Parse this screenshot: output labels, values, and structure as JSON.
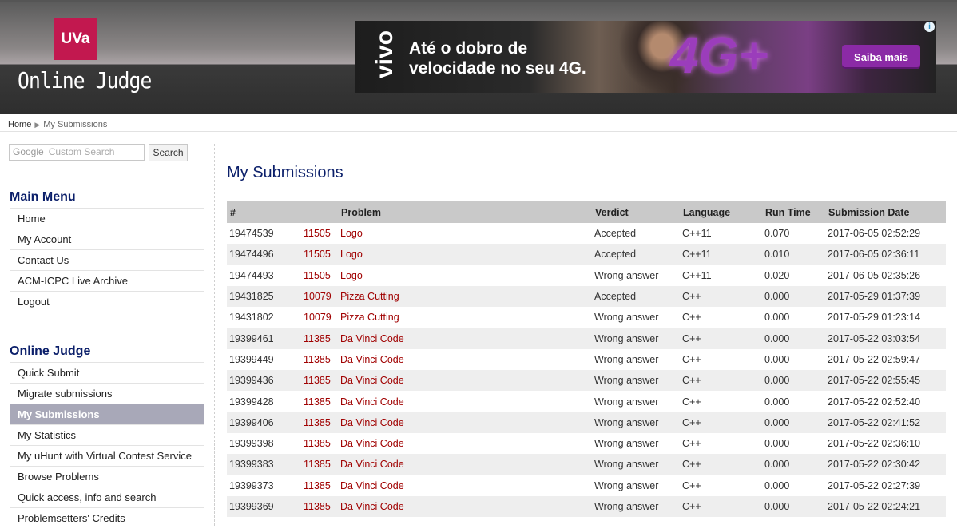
{
  "header": {
    "logo_text": "UVa",
    "site_title": "Online Judge"
  },
  "ad": {
    "brand": "vivo",
    "line1": "Até o dobro de",
    "line2": "velocidade no seu 4G.",
    "badge": "4G+",
    "cta": "Saiba mais",
    "info": "i"
  },
  "breadcrumb": {
    "home": "Home",
    "current": "My Submissions"
  },
  "search": {
    "placeholder_brand": "Google",
    "placeholder": "Custom Search",
    "button_label": "Search"
  },
  "main_menu": {
    "title": "Main Menu",
    "items": [
      "Home",
      "My Account",
      "Contact Us",
      "ACM-ICPC Live Archive",
      "Logout"
    ]
  },
  "oj_menu": {
    "title": "Online Judge",
    "items": [
      "Quick Submit",
      "Migrate submissions",
      "My Submissions",
      "My Statistics",
      "My uHunt with Virtual Contest Service",
      "Browse Problems",
      "Quick access, info and search",
      "Problemsetters' Credits"
    ],
    "active": "My Submissions"
  },
  "page_title": "My Submissions",
  "table": {
    "headers": [
      "#",
      "",
      "Problem",
      "Verdict",
      "Language",
      "Run Time",
      "Submission Date"
    ],
    "rows": [
      [
        "19474539",
        "11505",
        "Logo",
        "Accepted",
        "C++11",
        "0.070",
        "2017-06-05 02:52:29"
      ],
      [
        "19474496",
        "11505",
        "Logo",
        "Accepted",
        "C++11",
        "0.010",
        "2017-06-05 02:36:11"
      ],
      [
        "19474493",
        "11505",
        "Logo",
        "Wrong answer",
        "C++11",
        "0.020",
        "2017-06-05 02:35:26"
      ],
      [
        "19431825",
        "10079",
        "Pizza Cutting",
        "Accepted",
        "C++",
        "0.000",
        "2017-05-29 01:37:39"
      ],
      [
        "19431802",
        "10079",
        "Pizza Cutting",
        "Wrong answer",
        "C++",
        "0.000",
        "2017-05-29 01:23:14"
      ],
      [
        "19399461",
        "11385",
        "Da Vinci Code",
        "Wrong answer",
        "C++",
        "0.000",
        "2017-05-22 03:03:54"
      ],
      [
        "19399449",
        "11385",
        "Da Vinci Code",
        "Wrong answer",
        "C++",
        "0.000",
        "2017-05-22 02:59:47"
      ],
      [
        "19399436",
        "11385",
        "Da Vinci Code",
        "Wrong answer",
        "C++",
        "0.000",
        "2017-05-22 02:55:45"
      ],
      [
        "19399428",
        "11385",
        "Da Vinci Code",
        "Wrong answer",
        "C++",
        "0.000",
        "2017-05-22 02:52:40"
      ],
      [
        "19399406",
        "11385",
        "Da Vinci Code",
        "Wrong answer",
        "C++",
        "0.000",
        "2017-05-22 02:41:52"
      ],
      [
        "19399398",
        "11385",
        "Da Vinci Code",
        "Wrong answer",
        "C++",
        "0.000",
        "2017-05-22 02:36:10"
      ],
      [
        "19399383",
        "11385",
        "Da Vinci Code",
        "Wrong answer",
        "C++",
        "0.000",
        "2017-05-22 02:30:42"
      ],
      [
        "19399373",
        "11385",
        "Da Vinci Code",
        "Wrong answer",
        "C++",
        "0.000",
        "2017-05-22 02:27:39"
      ],
      [
        "19399369",
        "11385",
        "Da Vinci Code",
        "Wrong answer",
        "C++",
        "0.000",
        "2017-05-22 02:24:21"
      ]
    ]
  }
}
